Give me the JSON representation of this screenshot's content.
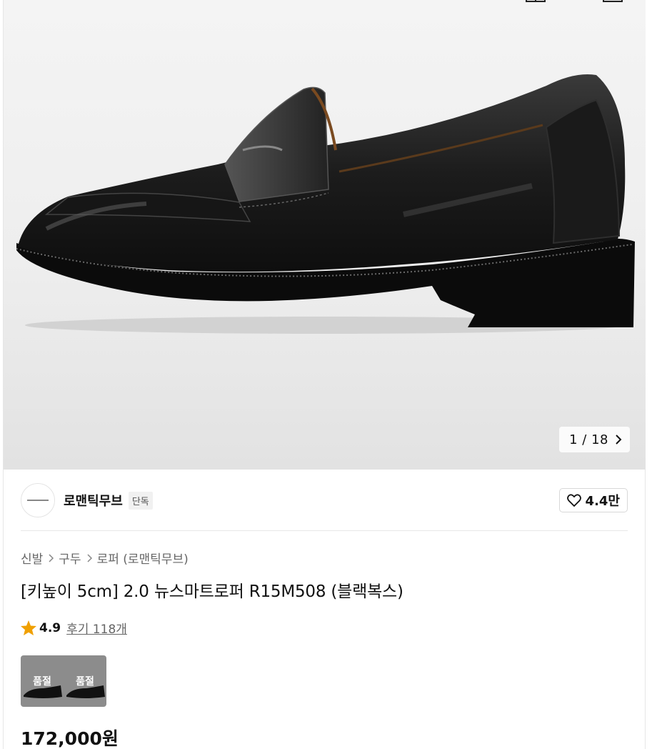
{
  "gallery": {
    "current": "1",
    "total": "18",
    "counter_text": "1 / 18"
  },
  "brand": {
    "name": "로맨틱무브",
    "badge": "단독",
    "likes": "4.4만"
  },
  "breadcrumb": {
    "items": [
      "신발",
      "구두",
      "로퍼 (로맨틱무브)"
    ]
  },
  "product": {
    "title": "[키높이 5cm] 2.0 뉴스마트로퍼 R15M508 (블랙복스)",
    "rating": "4.9",
    "reviews_label": "후기 118개",
    "price": "172,000원"
  },
  "options": {
    "thumbs": [
      {
        "status": "품절"
      },
      {
        "status": "품절"
      }
    ]
  },
  "colors": {
    "star": "#f0a000",
    "text": "#111111",
    "muted": "#666666"
  }
}
